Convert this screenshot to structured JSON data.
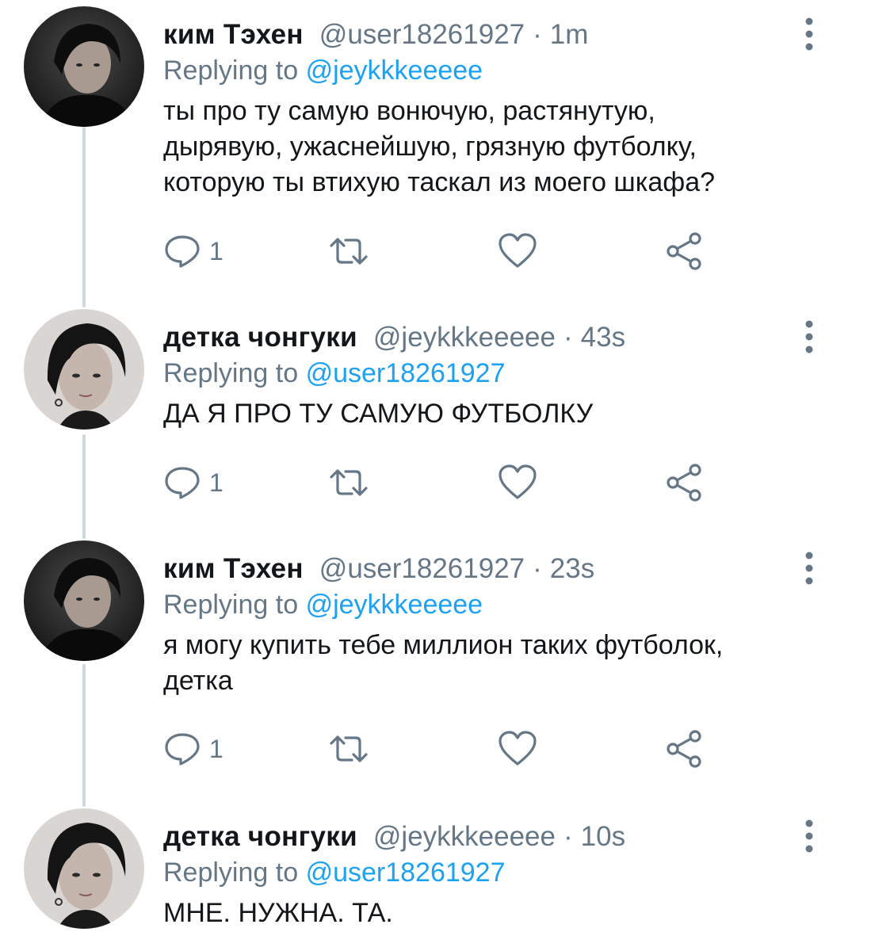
{
  "colors": {
    "accent": "#1da1f2",
    "secondary_text": "#657786",
    "primary_text": "#14171a",
    "thread_line": "#cfd9de"
  },
  "tweets": [
    {
      "name": "ким Тэхен",
      "handle": "@user18261927",
      "separator": "·",
      "time": "1m",
      "replying_label": "Replying to",
      "replying_to": "@jeykkkeeeee",
      "text_lines": [
        "ты про ту самую вонючую, растянутую,",
        "дырявую, ужаснейшую, грязную футболку,",
        "которую ты втихую таскал из моего шкафа?"
      ],
      "reply_count": "1",
      "avatar_icon": "avatar-dark-hair-icon",
      "more_icon": "more-vertical-icon"
    },
    {
      "name": "детка чонгуки",
      "handle": "@jeykkkeeeee",
      "separator": "·",
      "time": "43s",
      "replying_label": "Replying to",
      "replying_to": "@user18261927",
      "text_lines": [
        "ДА Я ПРО ТУ САМУЮ ФУТБОЛКУ"
      ],
      "reply_count": "1",
      "avatar_icon": "avatar-light-face-icon",
      "more_icon": "more-vertical-icon"
    },
    {
      "name": "ким Тэхен",
      "handle": "@user18261927",
      "separator": "·",
      "time": "23s",
      "replying_label": "Replying to",
      "replying_to": "@jeykkkeeeee",
      "text_lines": [
        "я могу купить тебе миллион таких футболок,",
        "детка"
      ],
      "reply_count": "1",
      "avatar_icon": "avatar-dark-hair-icon",
      "more_icon": "more-vertical-icon"
    },
    {
      "name": "детка чонгуки",
      "handle": "@jeykkkeeeee",
      "separator": "·",
      "time": "10s",
      "replying_label": "Replying to",
      "replying_to": "@user18261927",
      "text_lines": [
        "МНЕ. НУЖНА. ТА."
      ],
      "avatar_icon": "avatar-light-face-icon",
      "more_icon": "more-vertical-icon"
    }
  ]
}
